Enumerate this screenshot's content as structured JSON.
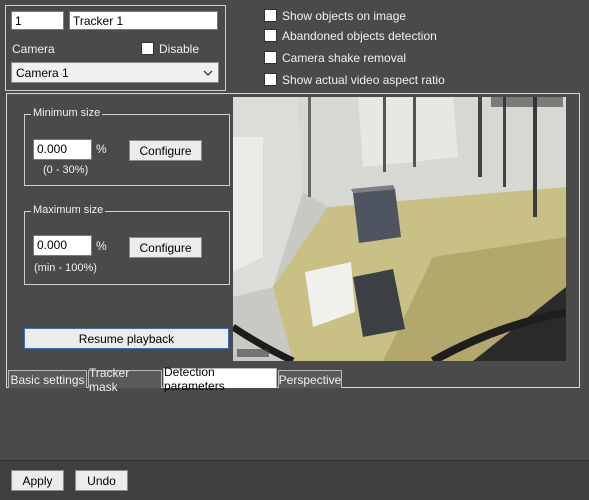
{
  "tracker": {
    "id_value": "1",
    "name_value": "Tracker 1",
    "camera_label": "Camera",
    "disable_label": "Disable",
    "camera_selected": "Camera 1"
  },
  "options": {
    "show_objects": "Show objects on image",
    "abandoned": "Abandoned objects detection",
    "shake": "Camera shake removal",
    "aspect": "Show actual video aspect ratio"
  },
  "min_size": {
    "title": "Minimum size",
    "value": "0.000",
    "unit": "%",
    "configure": "Configure",
    "range": "(0 - 30%)"
  },
  "max_size": {
    "title": "Maximum size",
    "value": "0.000",
    "unit": "%",
    "configure": "Configure",
    "range": "(min - 100%)"
  },
  "resume_label": "Resume playback",
  "tabs": [
    {
      "label": "Basic settings"
    },
    {
      "label": "Tracker mask"
    },
    {
      "label": "Detection parameters"
    },
    {
      "label": "Perspective"
    }
  ],
  "footer": {
    "apply": "Apply",
    "undo": "Undo"
  }
}
